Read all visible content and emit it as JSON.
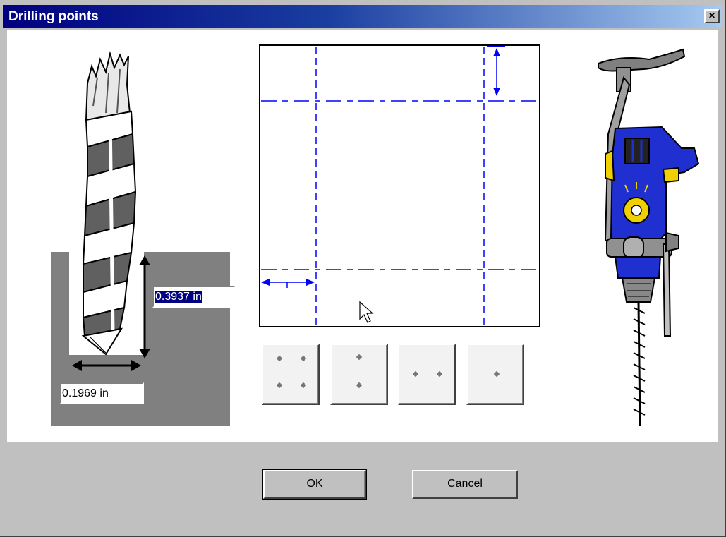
{
  "window": {
    "title": "Drilling points",
    "close_label": "×"
  },
  "hole": {
    "depth_value": "0.3937 in",
    "diameter_value": "0.1969 in"
  },
  "pattern_buttons": [
    {
      "icon": "four-points-icon"
    },
    {
      "icon": "two-points-vertical-icon"
    },
    {
      "icon": "two-points-horizontal-icon"
    },
    {
      "icon": "single-point-icon"
    }
  ],
  "buttons": {
    "ok_label": "OK",
    "cancel_label": "Cancel"
  },
  "colors": {
    "guide": "#0000ff",
    "titlebar_start": "#000080",
    "drill_body": "#1f2fd0",
    "drill_accent": "#f0d000"
  }
}
